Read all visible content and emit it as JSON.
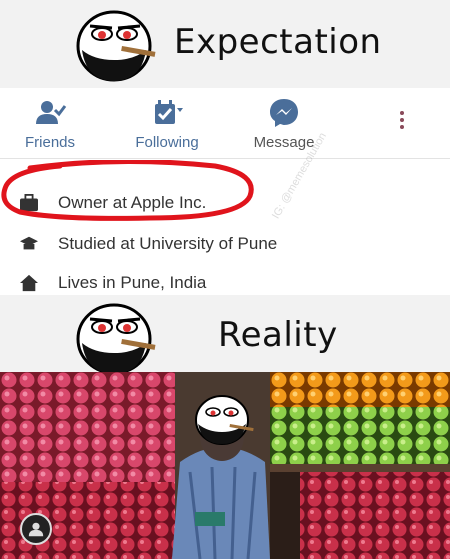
{
  "top": {
    "heading": "Expectation"
  },
  "profile": {
    "actions": [
      {
        "label": "Friends",
        "icon": "friend-check-icon"
      },
      {
        "label": "Following",
        "icon": "rss-feed-icon"
      },
      {
        "label": "Message",
        "icon": "messenger-icon"
      }
    ],
    "more_icon": "more-vertical-icon",
    "info": [
      {
        "text": "Owner at Apple Inc.",
        "icon": "briefcase-icon"
      },
      {
        "text": "Studied at University of Pune",
        "icon": "graduation-cap-icon"
      },
      {
        "text": "Lives in Pune, India",
        "icon": "home-icon"
      }
    ],
    "accent_color": "#4a6e9a",
    "circle_color": "#e0141c"
  },
  "bottom": {
    "heading": "Reality"
  }
}
